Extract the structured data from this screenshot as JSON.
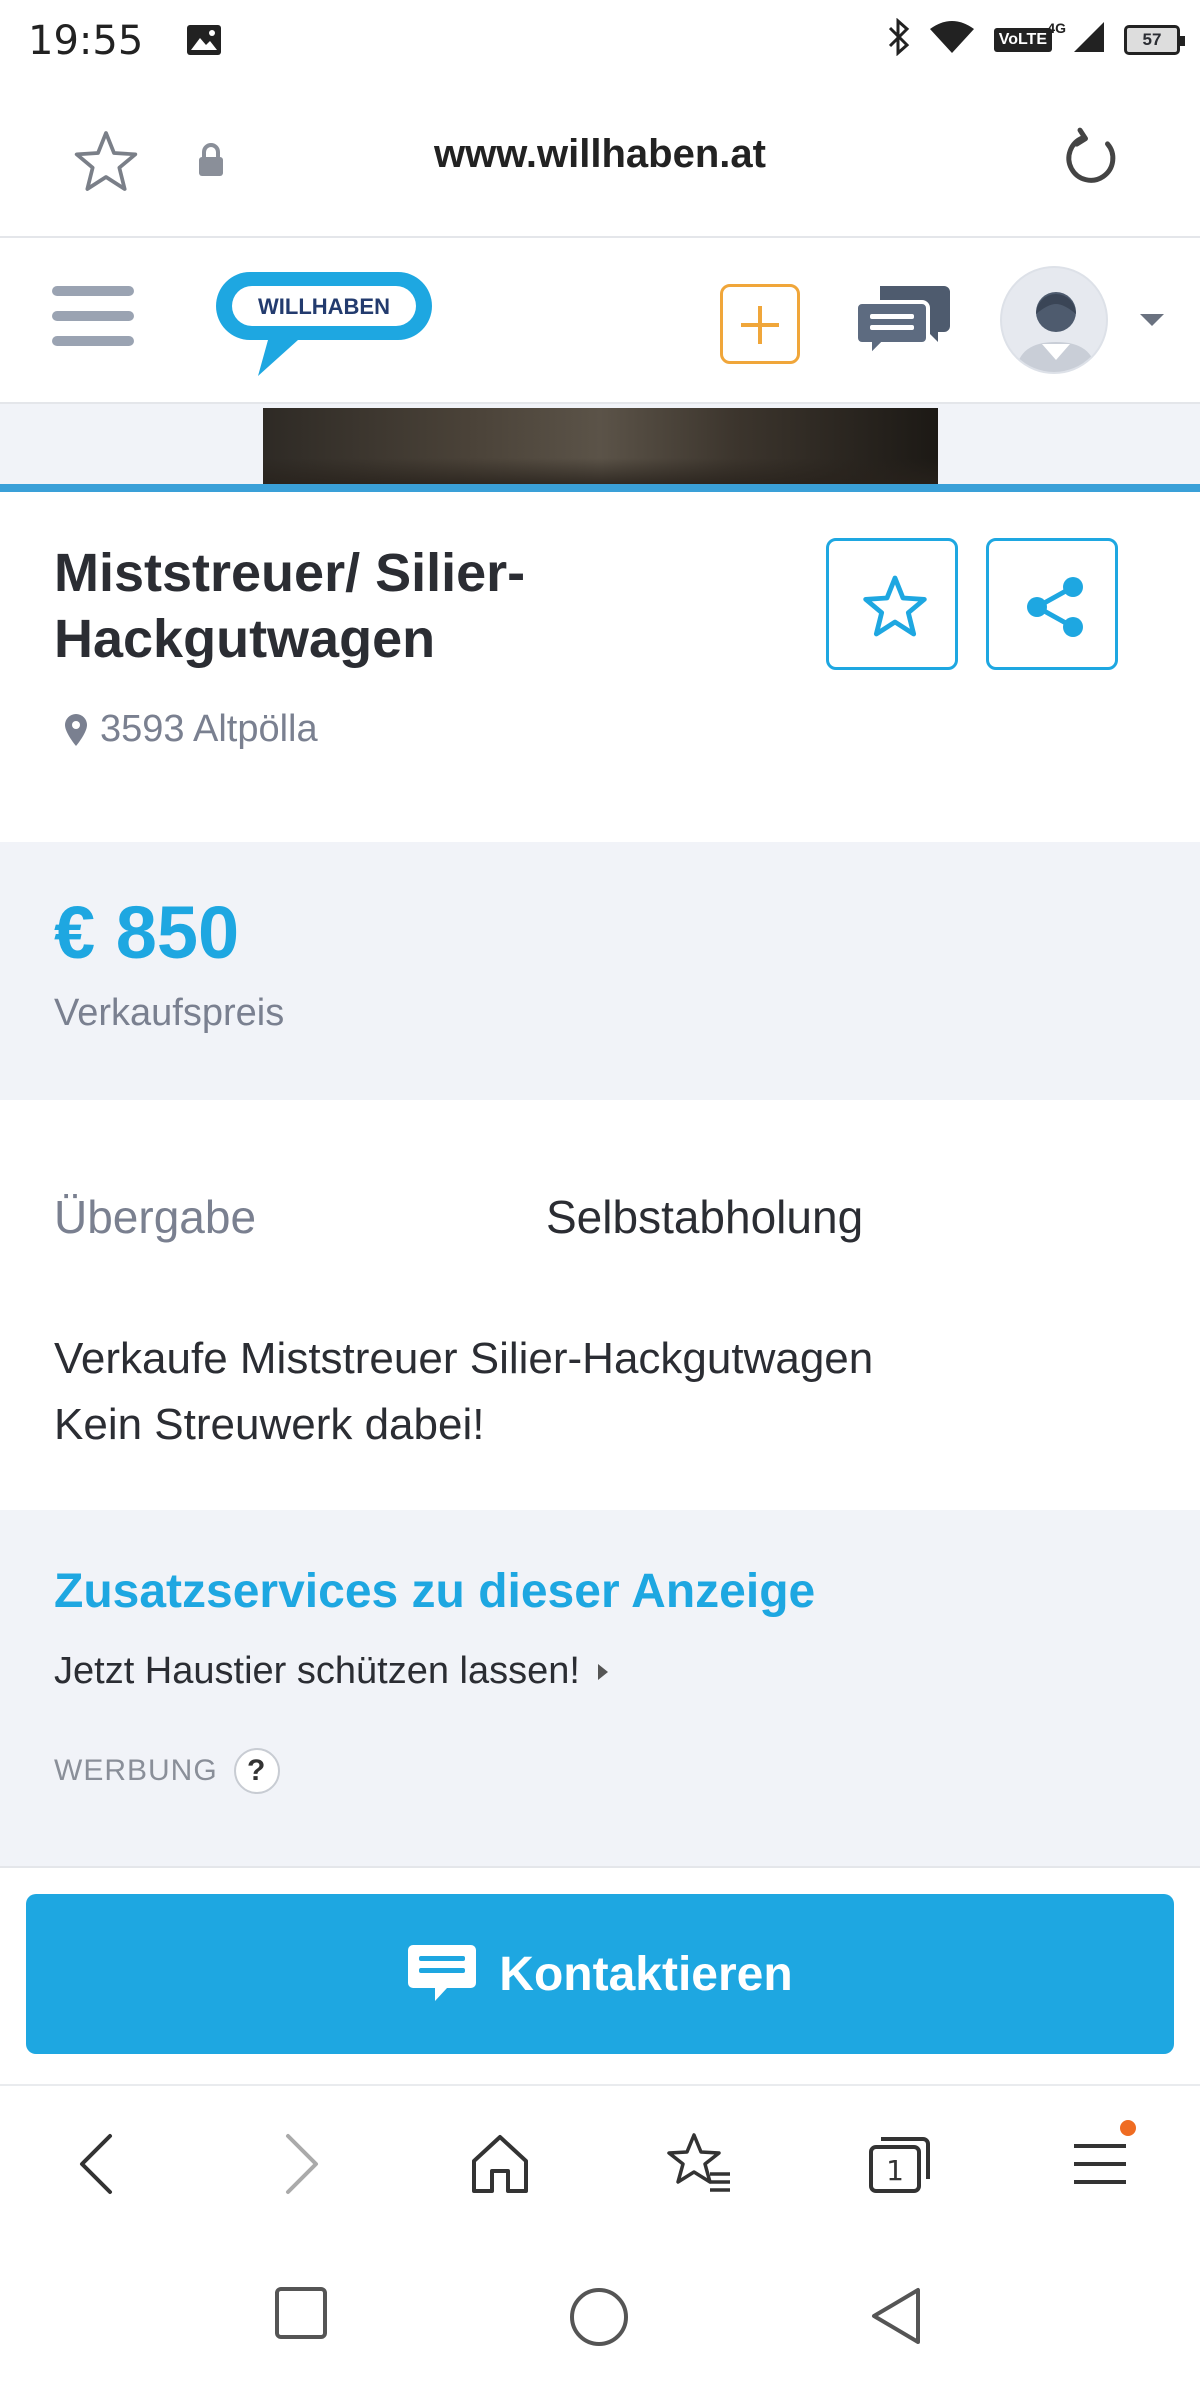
{
  "status": {
    "time": "19:55",
    "network": "VoLTE",
    "net_gen": "4G",
    "battery": "57"
  },
  "browser": {
    "url": "www.willhaben.at"
  },
  "site": {
    "logo_text": "WILLHABEN",
    "brand_color": "#1ea7e1",
    "accent_post": "#f0a63a"
  },
  "listing": {
    "title": "Miststreuer/ Silier-Hackgutwagen",
    "location": "3593 Altpölla",
    "price": "€ 850",
    "price_label": "Verkaufspreis",
    "attributes": [
      {
        "label": "Übergabe",
        "value": "Selbstabholung"
      }
    ],
    "description_lines": [
      "Verkaufe Miststreuer Silier-Hackgutwagen",
      "Kein Streuwerk dabei!"
    ]
  },
  "services": {
    "title": "Zusatzservices zu dieser Anzeige",
    "link": "Jetzt Haustier schützen lassen!",
    "ad_label": "WERBUNG",
    "help": "?"
  },
  "contact": {
    "label": "Kontaktieren"
  },
  "browser_toolbar": {
    "tabs_count": "1"
  }
}
